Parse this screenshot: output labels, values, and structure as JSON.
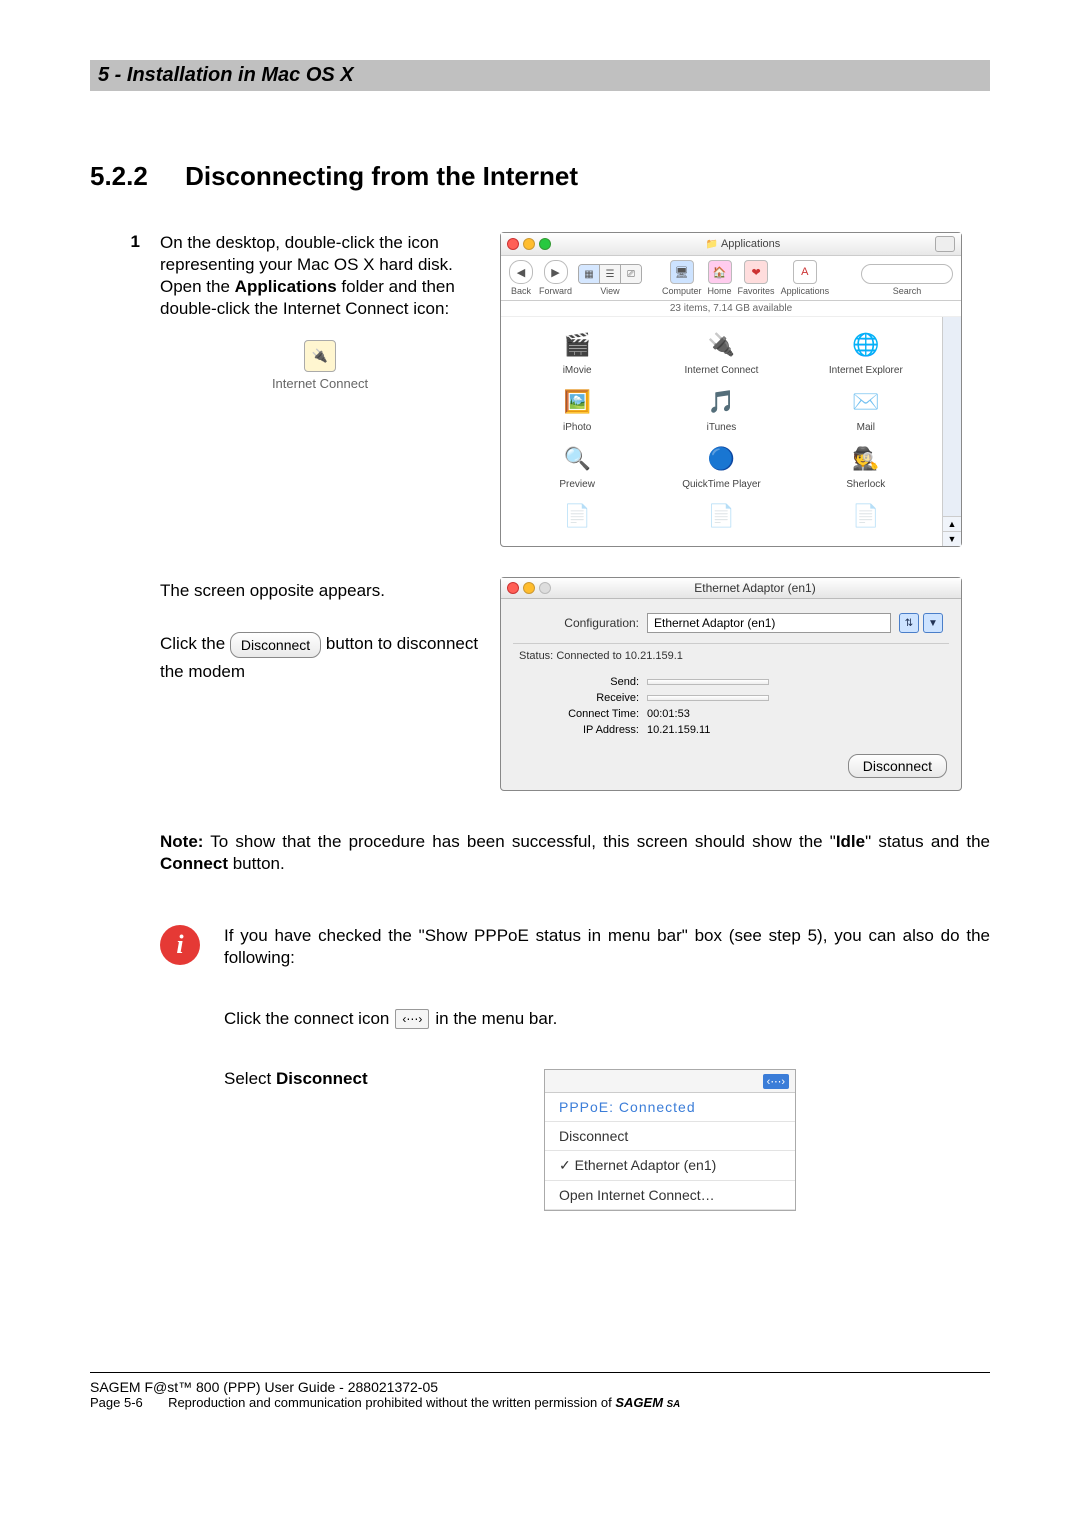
{
  "header": {
    "title": "5 - Installation in Mac OS X"
  },
  "section": {
    "number": "5.2.2",
    "title": "Disconnecting from the Internet"
  },
  "step1": {
    "num": "1",
    "text_a": "On the desktop, double-click the icon representing your Mac OS X hard disk. Open the ",
    "text_b": "Applications",
    "text_c": " folder and then double-click the Internet Connect icon:",
    "ic_label": "Internet Connect"
  },
  "finder": {
    "title": "Applications",
    "toolbar": {
      "back": "Back",
      "forward": "Forward",
      "view": "View",
      "computer": "Computer",
      "home": "Home",
      "favorites": "Favorites",
      "applications": "Applications",
      "search": "Search"
    },
    "status": "23 items, 7.14 GB available",
    "items": [
      {
        "name": "iMovie",
        "icon": "🎬"
      },
      {
        "name": "Internet Connect",
        "icon": "🔌"
      },
      {
        "name": "Internet Explorer",
        "icon": "🌐"
      },
      {
        "name": "iPhoto",
        "icon": "🖼️"
      },
      {
        "name": "iTunes",
        "icon": "🎵"
      },
      {
        "name": "Mail",
        "icon": "✉️"
      },
      {
        "name": "Preview",
        "icon": "🔍"
      },
      {
        "name": "QuickTime Player",
        "icon": "🔵"
      },
      {
        "name": "Sherlock",
        "icon": "🕵️"
      }
    ]
  },
  "step2": {
    "line1": "The screen opposite appears.",
    "click_the": "Click the ",
    "disc_label": "Disconnect",
    "after": " button to disconnect the modem"
  },
  "eth": {
    "title": "Ethernet Adaptor (en1)",
    "config_lbl": "Configuration:",
    "config_val": "Ethernet Adaptor (en1)",
    "status_lbl": "Status:",
    "status_val": "Connected to 10.21.159.1",
    "send": "Send:",
    "receive": "Receive:",
    "ct_lbl": "Connect Time:",
    "ct_val": "00:01:53",
    "ip_lbl": "IP Address:",
    "ip_val": "10.21.159.11",
    "disc": "Disconnect"
  },
  "note": {
    "lead": "Note:",
    "body_a": " To show that the procedure has been successful, this screen should show the \"",
    "idle": "Idle",
    "body_b": "\" status and the ",
    "connect": "Connect",
    "body_c": " button."
  },
  "info": {
    "text": "If you have checked the \"Show PPPoE status in menu bar\" box (see step 5), you can also do the following:"
  },
  "menubar": {
    "pre": "Click the connect icon ",
    "sym": "‹⋯›",
    "post": " in the menu bar."
  },
  "select": {
    "pre": "Select ",
    "bold": "Disconnect"
  },
  "menu": {
    "status": "PPPoE: Connected",
    "disconnect": "Disconnect",
    "adaptor": "Ethernet Adaptor (en1)",
    "open": "Open Internet Connect…",
    "sym": "‹⋯›"
  },
  "footer": {
    "line1": "SAGEM F@st™ 800 (PPP) User Guide - 288021372-05",
    "page": "Page 5-6",
    "perm_a": "Reproduction and communication prohibited without the written permission of ",
    "brand": "SAGEM ",
    "sa": "SA"
  }
}
